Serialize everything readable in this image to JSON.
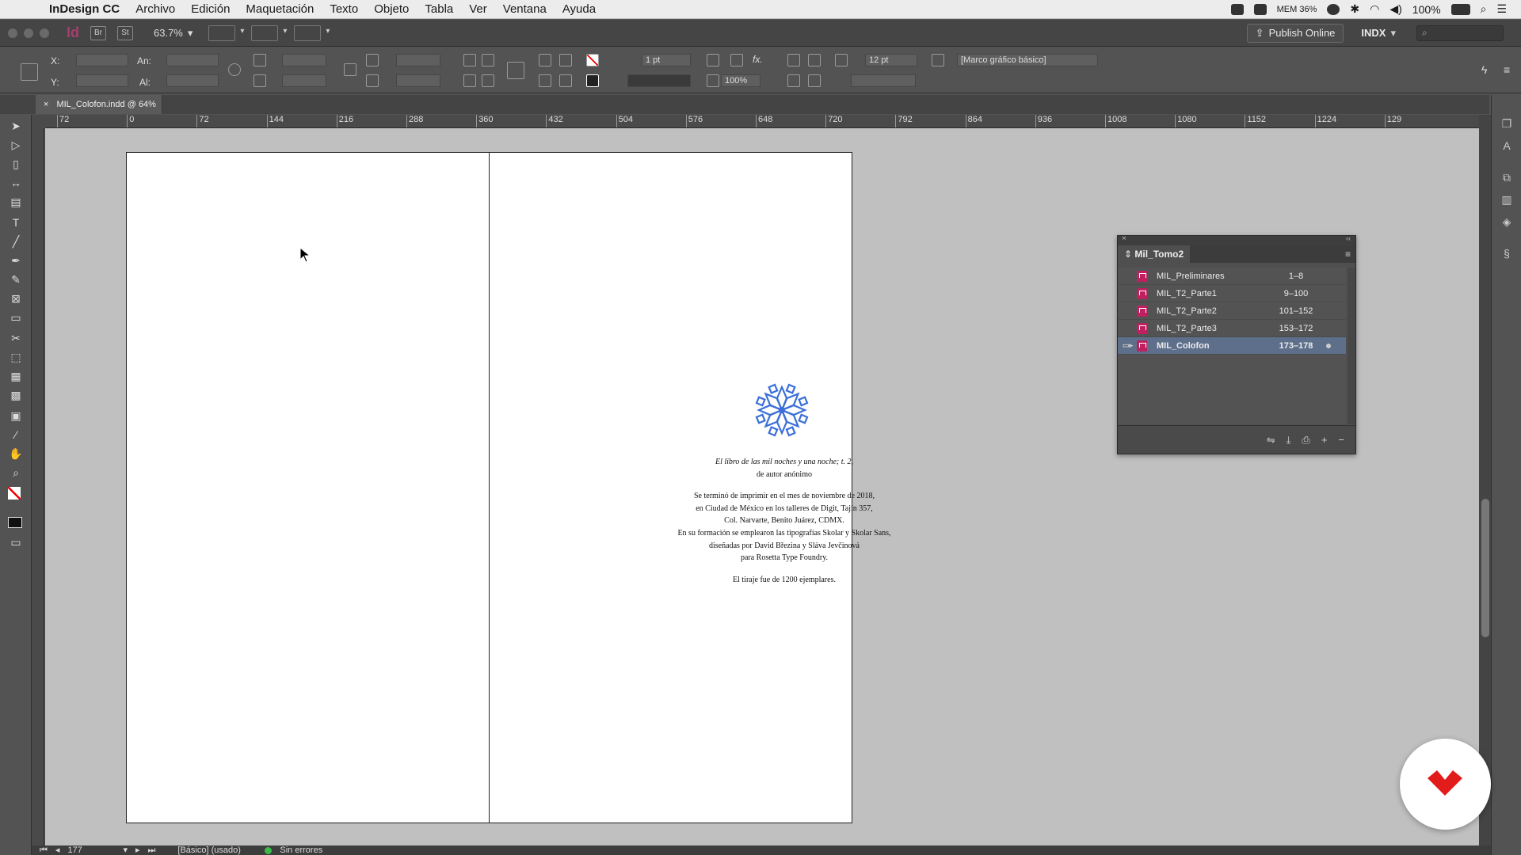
{
  "menubar": {
    "app": "InDesign CC",
    "items": [
      "Archivo",
      "Edición",
      "Maquetación",
      "Texto",
      "Objeto",
      "Tabla",
      "Ver",
      "Ventana",
      "Ayuda"
    ],
    "status": {
      "mem": "MEM 36%",
      "battery": "100%"
    }
  },
  "appbar": {
    "zoom": "63.7%",
    "br": "Br",
    "st": "St",
    "publish": "Publish Online",
    "workspace": "INDX"
  },
  "control": {
    "x_label": "X:",
    "y_label": "Y:",
    "w_label": "An:",
    "h_label": "Al:",
    "stroke_weight": "1 pt",
    "opacity": "100%",
    "size": "12 pt",
    "object_style": "[Marco gráfico básico]"
  },
  "document": {
    "tab": "MIL_Colofon.indd @ 64%",
    "ruler_ticks": [
      "72",
      "0",
      "72",
      "144",
      "216",
      "288",
      "360",
      "432",
      "504",
      "576",
      "648",
      "720",
      "792",
      "864",
      "936",
      "1008",
      "1080",
      "1152",
      "1224",
      "129"
    ]
  },
  "colophon": {
    "title_italic": "El libro de las mil noches y una noche; t. 2,",
    "line2": "de autor anónimo",
    "p2": [
      "Se terminó de imprimir en el mes de noviembre de 2018,",
      "en Ciudad de México en los talleres de Digit, Tajín 357,",
      "Col. Narvarte, Benito Juárez, CDMX.",
      "En su formación se emplearon las tipografías Skolar y Skolar Sans,",
      "diseñadas por David Březina y Sláva Jevčinová",
      "para Rosetta Type Foundry."
    ],
    "p3": "El tiraje fue de 1200 ejemplares."
  },
  "book_panel": {
    "title": "Mil_Tomo2",
    "rows": [
      {
        "name": "MIL_Preliminares",
        "pages": "1–8"
      },
      {
        "name": "MIL_T2_Parte1",
        "pages": "9–100"
      },
      {
        "name": "MIL_T2_Parte2",
        "pages": "101–152"
      },
      {
        "name": "MIL_T2_Parte3",
        "pages": "153–172"
      },
      {
        "name": "MIL_Colofon",
        "pages": "173–178",
        "selected": true
      }
    ]
  },
  "status": {
    "page": "177",
    "master": "[Básico] (usado)",
    "preflight": "Sin errores"
  },
  "colors": {
    "accent_pink": "#e73a8a",
    "emblem_blue": "#3a6fd8",
    "badge_red": "#e21b1b"
  }
}
